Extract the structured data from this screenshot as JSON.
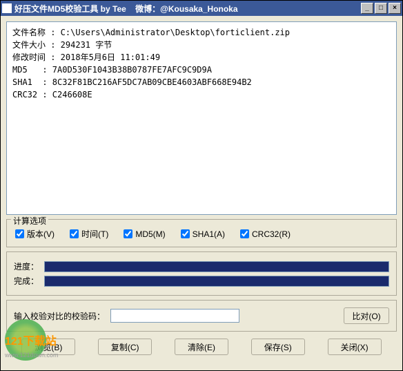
{
  "window": {
    "title": "好压文件MD5校验工具 by Tee    微博：@Kousaka_Honoka"
  },
  "output": {
    "lines": [
      "文件名称 : C:\\Users\\Administrator\\Desktop\\forticlient.zip",
      "文件大小 : 294231 字节",
      "修改时间 : 2018年5月6日 11:01:49",
      "MD5   : 7A0D530F1043B38B0787FE7AFC9C9D9A",
      "SHA1  : 8C32F81BC216AF5DC7AB09CBE4603ABF668E94B2",
      "CRC32 : C246608E"
    ]
  },
  "options": {
    "legend": "计算选项",
    "version": "版本(V)",
    "time": "时间(T)",
    "md5": "MD5(M)",
    "sha1": "SHA1(A)",
    "crc32": "CRC32(R)"
  },
  "progress": {
    "label1": "进度：",
    "label2": "完成："
  },
  "verify": {
    "label": "输入校验对比的校验码：",
    "compare": "比对(O)"
  },
  "buttons": {
    "browse": "浏览(B)",
    "copy": "复制(C)",
    "clear": "清除(E)",
    "save": "保存(S)",
    "close": "关闭(X)"
  },
  "watermark": {
    "text": "121下载站",
    "url": "www.121down.com"
  }
}
